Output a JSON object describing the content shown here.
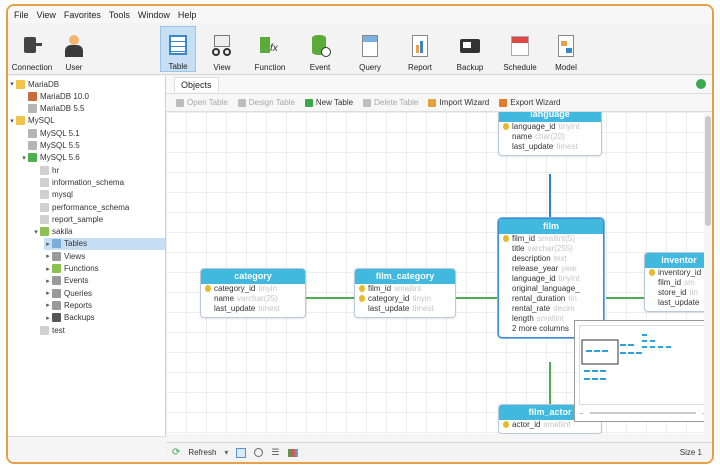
{
  "menu": [
    "File",
    "View",
    "Favorites",
    "Tools",
    "Window",
    "Help"
  ],
  "toolbar": [
    {
      "label": "Connection",
      "icon": "plug-icon"
    },
    {
      "label": "User",
      "icon": "user-icon"
    },
    {
      "label": "Table",
      "icon": "table-icon",
      "active": true
    },
    {
      "label": "View",
      "icon": "view-icon"
    },
    {
      "label": "Function",
      "icon": "function-icon"
    },
    {
      "label": "Event",
      "icon": "event-icon"
    },
    {
      "label": "Query",
      "icon": "query-icon"
    },
    {
      "label": "Report",
      "icon": "report-icon"
    },
    {
      "label": "Backup",
      "icon": "backup-icon"
    },
    {
      "label": "Schedule",
      "icon": "schedule-icon"
    },
    {
      "label": "Model",
      "icon": "model-icon"
    }
  ],
  "tree": [
    {
      "label": "MariaDB",
      "depth": 0,
      "arrow": "▾",
      "icon": "folder"
    },
    {
      "label": "MariaDB 10.0",
      "depth": 1,
      "arrow": "",
      "icon": "mariadb"
    },
    {
      "label": "MariaDB 5.5",
      "depth": 1,
      "arrow": "",
      "icon": "server-off"
    },
    {
      "label": "MySQL",
      "depth": 0,
      "arrow": "▾",
      "icon": "folder"
    },
    {
      "label": "MySQL 5.1",
      "depth": 1,
      "arrow": "",
      "icon": "server-off"
    },
    {
      "label": "MySQL 5.5",
      "depth": 1,
      "arrow": "",
      "icon": "server-off"
    },
    {
      "label": "MySQL 5.6",
      "depth": 1,
      "arrow": "▾",
      "icon": "server-on"
    },
    {
      "label": "hr",
      "depth": 2,
      "arrow": "",
      "icon": "db"
    },
    {
      "label": "information_schema",
      "depth": 2,
      "arrow": "",
      "icon": "db"
    },
    {
      "label": "mysql",
      "depth": 2,
      "arrow": "",
      "icon": "db"
    },
    {
      "label": "performance_schema",
      "depth": 2,
      "arrow": "",
      "icon": "db"
    },
    {
      "label": "report_sample",
      "depth": 2,
      "arrow": "",
      "icon": "db"
    },
    {
      "label": "sakila",
      "depth": 2,
      "arrow": "▾",
      "icon": "db-open"
    },
    {
      "label": "Tables",
      "depth": 3,
      "arrow": "▸",
      "icon": "tables",
      "selected": true
    },
    {
      "label": "Views",
      "depth": 3,
      "arrow": "▸",
      "icon": "views"
    },
    {
      "label": "Functions",
      "depth": 3,
      "arrow": "▸",
      "icon": "functions"
    },
    {
      "label": "Events",
      "depth": 3,
      "arrow": "▸",
      "icon": "events"
    },
    {
      "label": "Queries",
      "depth": 3,
      "arrow": "▸",
      "icon": "queries"
    },
    {
      "label": "Reports",
      "depth": 3,
      "arrow": "▸",
      "icon": "reports"
    },
    {
      "label": "Backups",
      "depth": 3,
      "arrow": "▸",
      "icon": "backups"
    },
    {
      "label": "test",
      "depth": 2,
      "arrow": "",
      "icon": "db"
    }
  ],
  "objects_tab": "Objects",
  "object_tools": [
    {
      "label": "Open Table",
      "enabled": false,
      "color": "#bdbdbd"
    },
    {
      "label": "Design Table",
      "enabled": false,
      "color": "#bdbdbd"
    },
    {
      "label": "New Table",
      "enabled": true,
      "color": "#3aa94b"
    },
    {
      "label": "Delete Table",
      "enabled": false,
      "color": "#bdbdbd"
    },
    {
      "label": "Import Wizard",
      "enabled": true,
      "color": "#e6a238"
    },
    {
      "label": "Export Wizard",
      "enabled": true,
      "color": "#e07a2c"
    }
  ],
  "tables": [
    {
      "id": "language",
      "title": "language",
      "fields": [
        {
          "name": "language_id",
          "type": "tinyint",
          "key": true
        },
        {
          "name": "name",
          "type": "char(20)",
          "key": false
        },
        {
          "name": "last_update",
          "type": "timest",
          "key": false
        }
      ]
    },
    {
      "id": "category",
      "title": "category",
      "fields": [
        {
          "name": "category_id",
          "type": "tinyin",
          "key": true
        },
        {
          "name": "name",
          "type": "varchar(25)",
          "key": false
        },
        {
          "name": "last_update",
          "type": "timest",
          "key": false
        }
      ]
    },
    {
      "id": "film_category",
      "title": "film_category",
      "fields": [
        {
          "name": "film_id",
          "type": "smallint",
          "key": true
        },
        {
          "name": "category_id",
          "type": "tinyin",
          "key": true
        },
        {
          "name": "last_update",
          "type": "timest",
          "key": false
        }
      ]
    },
    {
      "id": "film",
      "title": "film",
      "selected": true,
      "fields": [
        {
          "name": "film_id",
          "type": "smallint(5)",
          "key": true
        },
        {
          "name": "title",
          "type": "varchar(255)",
          "key": false
        },
        {
          "name": "description",
          "type": "text",
          "key": false
        },
        {
          "name": "release_year",
          "type": "year",
          "key": false
        },
        {
          "name": "language_id",
          "type": "tinyint",
          "key": false
        },
        {
          "name": "original_language_",
          "type": "",
          "key": false
        },
        {
          "name": "rental_duration",
          "type": "tin",
          "key": false
        },
        {
          "name": "rental_rate",
          "type": "decim",
          "key": false
        },
        {
          "name": "length",
          "type": "smallint",
          "key": false
        },
        {
          "name": "2 more columns",
          "type": "",
          "key": false
        }
      ]
    },
    {
      "id": "inventory",
      "title": "inventor",
      "fields": [
        {
          "name": "inventory_id",
          "type": "",
          "key": true
        },
        {
          "name": "film_id",
          "type": "sm",
          "key": false
        },
        {
          "name": "store_id",
          "type": "tin",
          "key": false
        },
        {
          "name": "last_update",
          "type": "",
          "key": false
        }
      ]
    },
    {
      "id": "film_actor",
      "title": "film_actor",
      "fields": [
        {
          "name": "actor_id",
          "type": "smallint",
          "key": true
        }
      ]
    }
  ],
  "status": {
    "refresh": "Refresh",
    "size": "Size 1"
  },
  "colors": {
    "accent": "#41b9df",
    "link_green": "#4caf50",
    "link_blue": "#2f7fd1",
    "frame": "#e8a046"
  }
}
